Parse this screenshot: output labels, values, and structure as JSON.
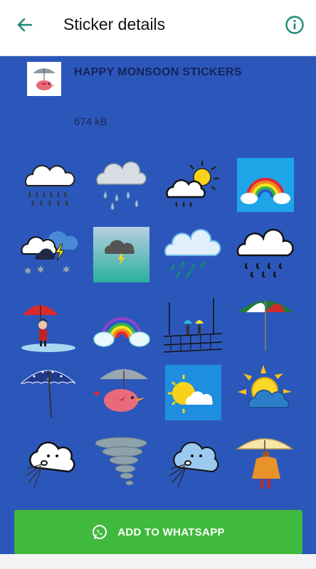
{
  "appbar": {
    "title": "Sticker details"
  },
  "pack": {
    "name": "HAPPY MONSOON STICKERS",
    "size": "674 kB"
  },
  "stickers": [
    {
      "icon": "rain-cloud-sticker"
    },
    {
      "icon": "heavy-rain-cloud-sticker"
    },
    {
      "icon": "sun-cloud-rain-sticker"
    },
    {
      "icon": "rainbow-tile-sticker"
    },
    {
      "icon": "thunderstorm-sticker"
    },
    {
      "icon": "storm-tile-sticker"
    },
    {
      "icon": "blue-cloud-rain-sticker"
    },
    {
      "icon": "outline-cloud-rain-sticker"
    },
    {
      "icon": "girl-umbrella-sticker"
    },
    {
      "icon": "rainbow-clouds-sticker"
    },
    {
      "icon": "couple-umbrellas-sticker"
    },
    {
      "icon": "striped-umbrella-sticker"
    },
    {
      "icon": "dotted-umbrella-sticker"
    },
    {
      "icon": "bird-umbrella-sticker"
    },
    {
      "icon": "sun-cloud-tile-sticker"
    },
    {
      "icon": "sun-behind-cloud-sticker"
    },
    {
      "icon": "blowing-cloud-sticker"
    },
    {
      "icon": "tornado-sticker"
    },
    {
      "icon": "blue-blowing-cloud-sticker"
    },
    {
      "icon": "woman-raincoat-sticker"
    }
  ],
  "button": {
    "label": "ADD TO WHATSAPP"
  },
  "colors": {
    "accent": "#1a8a7a",
    "background": "#2c57ba",
    "button": "#3fba3c"
  }
}
